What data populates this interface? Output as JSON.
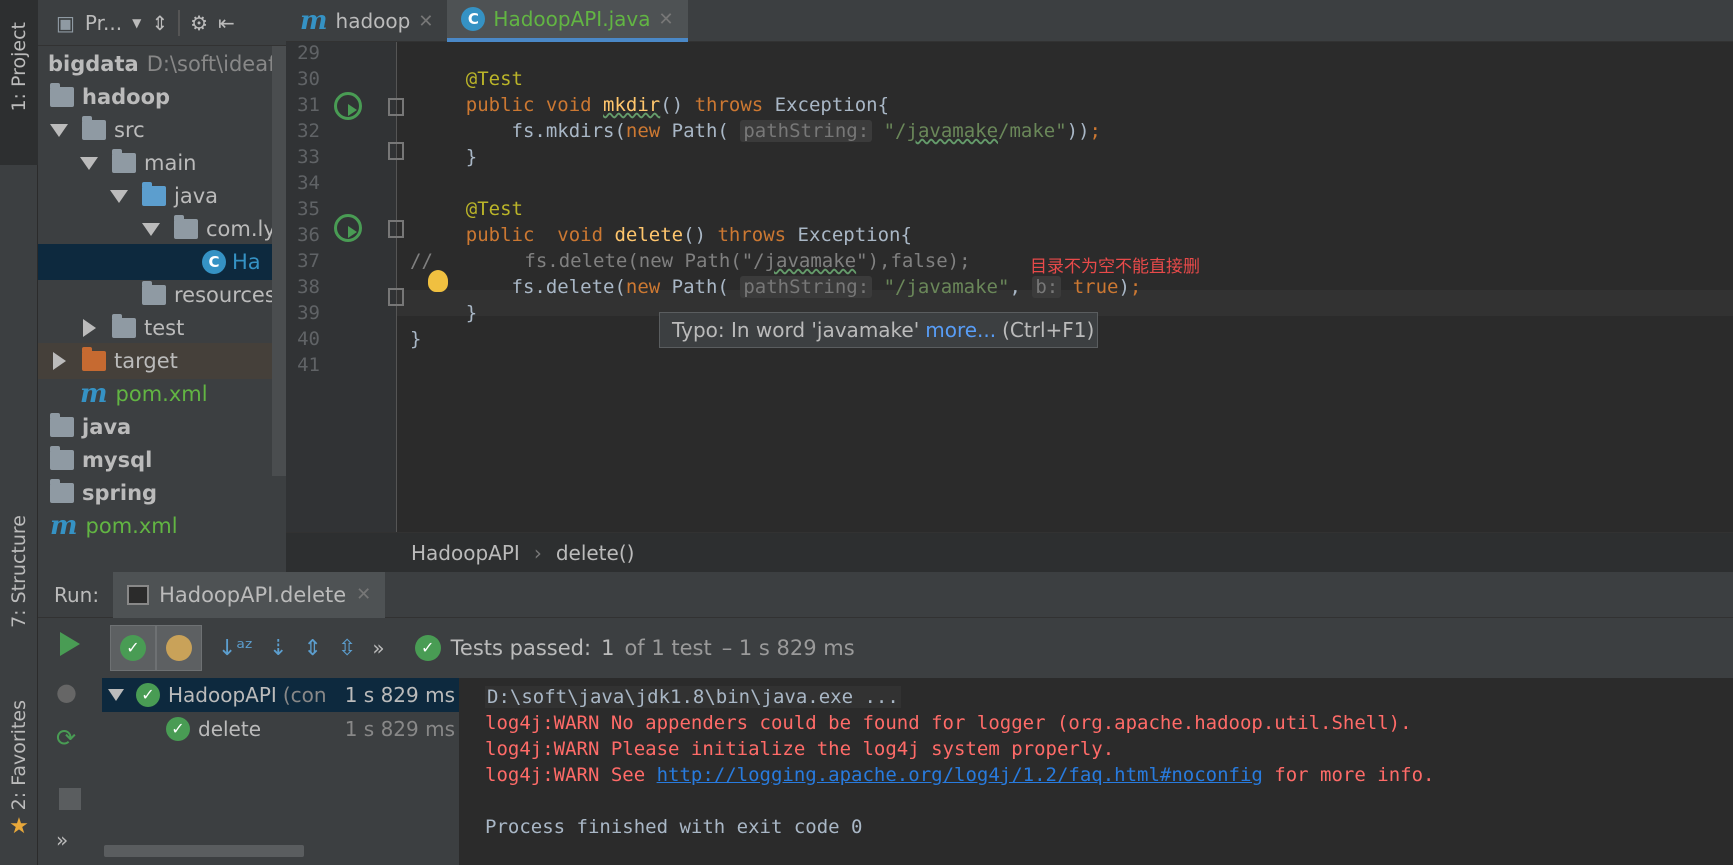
{
  "left_strip": {
    "project_tab": "1: Project",
    "structure_tab": "7: Structure",
    "favorites_tab": "2: Favorites"
  },
  "project_panel": {
    "toolbar_label": "Pr...",
    "tree": [
      {
        "label": "bigdata",
        "path": "D:\\soft\\ideafil",
        "kind": "root"
      },
      {
        "label": "hadoop",
        "kind": "module"
      },
      {
        "label": "src",
        "kind": "folder"
      },
      {
        "label": "main",
        "kind": "folder"
      },
      {
        "label": "java",
        "kind": "source"
      },
      {
        "label": "com.ly",
        "kind": "package"
      },
      {
        "label": "Ha",
        "kind": "class"
      },
      {
        "label": "resources",
        "kind": "resources"
      },
      {
        "label": "test",
        "kind": "folder"
      },
      {
        "label": "target",
        "kind": "excluded"
      },
      {
        "label": "pom.xml",
        "kind": "maven"
      },
      {
        "label": "java",
        "kind": "module"
      },
      {
        "label": "mysql",
        "kind": "module"
      },
      {
        "label": "spring",
        "kind": "module"
      },
      {
        "label": "pom.xml",
        "kind": "maven"
      }
    ]
  },
  "tabs": [
    {
      "label": "hadoop",
      "icon": "maven-icon"
    },
    {
      "label": "HadoopAPI.java",
      "icon": "class-icon"
    }
  ],
  "editor": {
    "line_numbers": [
      "29",
      "30",
      "31",
      "32",
      "33",
      "34",
      "35",
      "36",
      "37",
      "38",
      "39",
      "40",
      "41"
    ],
    "comment_note": "目录不为空不能直接删",
    "tooltip": {
      "text": "Typo: In word 'javamake'",
      "link": "more...",
      "shortcut": "(Ctrl+F1)"
    }
  },
  "breadcrumb": {
    "class_name": "HadoopAPI",
    "method_name": "delete()"
  },
  "run": {
    "label": "Run:",
    "tab_label": "HadoopAPI.delete",
    "status": {
      "prefix": "Tests passed:",
      "count": "1",
      "suffix": "of 1 test",
      "duration": "– 1 s 829 ms"
    },
    "tests": [
      {
        "name": "HadoopAPI",
        "extra": "(con",
        "time": "1 s 829 ms"
      },
      {
        "name": "delete",
        "extra": "",
        "time": "1 s 829 ms"
      }
    ],
    "console": {
      "cmd": "D:\\soft\\java\\jdk1.8\\bin\\java.exe ...",
      "warn1": "log4j:WARN No appenders could be found for logger (org.apache.hadoop.util.Shell).",
      "warn2": "log4j:WARN Please initialize the log4j system properly.",
      "warn3_prefix": "log4j:WARN See ",
      "warn3_link": "http://logging.apache.org/log4j/1.2/faq.html#noconfig",
      "warn3_suffix": " for more info.",
      "exit": "Process finished with exit code 0"
    }
  }
}
